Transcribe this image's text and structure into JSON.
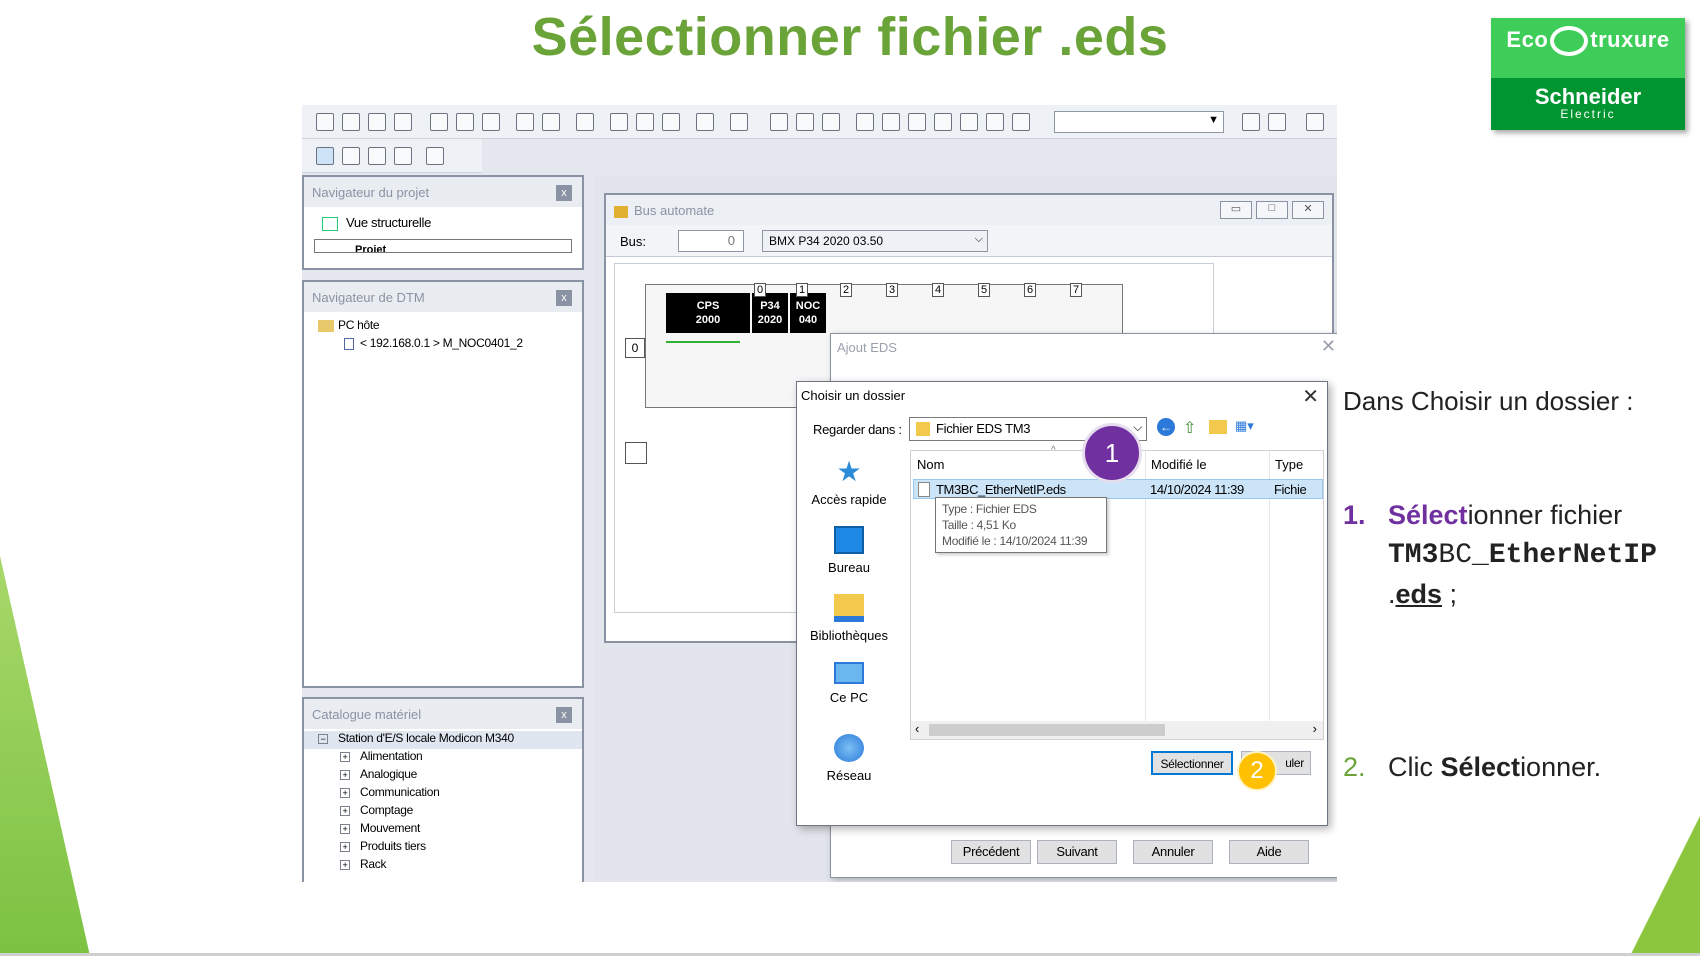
{
  "slide": {
    "title_bold1": "Sélect",
    "title_normal": "ionner fichier ",
    "title_bold2": ".eds",
    "intro": "Dans Choisir un dossier :",
    "step1": {
      "num": "1.",
      "purple_part": "Sélect",
      "text_part": "ionner fichier",
      "file_bold1": "TM3",
      "file_mid": "BC_",
      "file_bold2": "EtherNetIP",
      "dot": ".",
      "ext": "eds",
      "end": " ;"
    },
    "step2": {
      "num": "2.",
      "pre": "Clic ",
      "bold": "Sélect",
      "rest": "ionner."
    },
    "colors": {
      "green": "#6aa338",
      "purple": "#7030a0",
      "badge1": "#7030a0",
      "badge2": "#ffc000"
    }
  },
  "logo": {
    "eco_left": "Eco",
    "eco_right": "truxure",
    "brand": "Schneider",
    "sub": "Electric"
  },
  "app": {
    "toolbar_icons": [
      "new-icon",
      "open-icon",
      "save-icon",
      "print-icon",
      "copy-icon",
      "cut-icon",
      "paste-icon",
      "undo-icon",
      "redo-icon",
      "check-icon",
      "search-icon",
      "replace-icon",
      "zoom-icon",
      "module-icon",
      "download-icon"
    ],
    "navigateur_projet": {
      "title": "Navigateur du projet",
      "close": "x",
      "item": "Vue structurelle",
      "sub": "Projet"
    },
    "navigateur_dtm": {
      "title": "Navigateur de DTM",
      "close": "x",
      "root": "PC hôte",
      "child": "< 192.168.0.1 > M_NOC0401_2"
    },
    "catalogue": {
      "title": "Catalogue matériel",
      "close": "x",
      "root": "Station d'E/S locale Modicon M340",
      "items": [
        "Alimentation",
        "Analogique",
        "Communication",
        "Comptage",
        "Mouvement",
        "Produits tiers",
        "Rack"
      ]
    },
    "bus_window": {
      "title": "Bus automate",
      "bus_label": "Bus:",
      "bus_value": "0",
      "cpu_select": "BMX P34 2020   03.50",
      "modules": [
        {
          "l1": "CPS",
          "l2": "2000"
        },
        {
          "l1": "P34",
          "l2": "2020"
        },
        {
          "l1": "NOC",
          "l2": "040"
        }
      ],
      "slots": [
        "0",
        "1",
        "2",
        "3",
        "4",
        "5",
        "6",
        "7"
      ],
      "rack_num": "0"
    },
    "ajout_eds": {
      "title": "Ajout EDS",
      "buttons": [
        "Précédent",
        "Suivant",
        "Annuler",
        "Aide"
      ]
    },
    "choisir": {
      "title": "Choisir un dossier",
      "look_in_label": "Regarder dans :",
      "look_in_value": "Fichier EDS TM3",
      "places": [
        "Accès rapide",
        "Bureau",
        "Bibliothèques",
        "Ce PC",
        "Réseau"
      ],
      "columns": [
        "Nom",
        "Modifié le",
        "Type"
      ],
      "file": {
        "name": "TM3BC_EtherNetIP.eds",
        "modified": "14/10/2024 11:39",
        "type": "Fichie"
      },
      "tooltip": [
        "Type : Fichier EDS",
        "Taille : 4,51 Ko",
        "Modifié le : 14/10/2024 11:39"
      ],
      "btn_select": "Sélectionner",
      "btn_cancel": "uler"
    },
    "badges": [
      "1",
      "2"
    ]
  }
}
